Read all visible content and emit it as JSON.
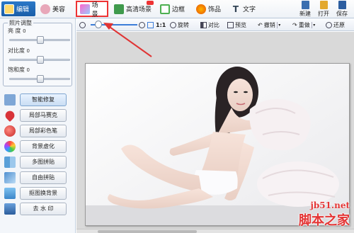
{
  "menu": {
    "tabs": [
      {
        "label": "编辑",
        "icon": "edit-icon",
        "active": true
      },
      {
        "label": "美容",
        "icon": "beauty-icon"
      },
      {
        "label": "场景",
        "icon": "scene-icon",
        "highlighted": true
      },
      {
        "label": "高清场景",
        "icon": "hd-scene-icon"
      },
      {
        "label": "边框",
        "icon": "frame-icon"
      },
      {
        "label": "饰品",
        "icon": "ornament-icon"
      },
      {
        "label": "文字",
        "icon": "text-icon"
      }
    ],
    "right_buttons": [
      {
        "label": "新建",
        "icon": "new-file-icon"
      },
      {
        "label": "打开",
        "icon": "open-folder-icon"
      },
      {
        "label": "保存",
        "icon": "save-icon"
      }
    ]
  },
  "adjust": {
    "group_title": "照片调整",
    "brightness": {
      "label": "亮  度",
      "value": "0",
      "level": 0.5
    },
    "contrast": {
      "label": "对比度",
      "value": "0",
      "level": 0.5
    },
    "saturation": {
      "label": "饱和度",
      "value": "0",
      "level": 0.5
    }
  },
  "tools": [
    {
      "label": "智能修复",
      "icon": "smart-repair-icon",
      "color": "#7fa7d6",
      "active": true
    },
    {
      "label": "局部马赛克",
      "icon": "mosaic-icon",
      "color": "#d8343a"
    },
    {
      "label": "局部彩色笔",
      "icon": "color-pen-icon",
      "color": "#c62828"
    },
    {
      "label": "背景虚化",
      "icon": "blur-background-icon",
      "color": "#8e6cc0"
    },
    {
      "label": "多图拼贴",
      "icon": "multi-collage-icon",
      "color": "#5aa0d8"
    },
    {
      "label": "自由拼贴",
      "icon": "free-collage-icon",
      "color": "#4f8fd0"
    },
    {
      "label": "抠图换背景",
      "icon": "cutout-icon",
      "color": "#3c86c9"
    },
    {
      "label": "去 水 印",
      "icon": "remove-watermark-icon",
      "color": "#2b5d9c"
    }
  ],
  "toolbar": {
    "ratio_label": "1:1",
    "rotate_label": "旋转",
    "compare_label": "对比",
    "preview_label": "预览",
    "undo_label": "撤销",
    "redo_label": "重做",
    "restore_label": "还原",
    "zoom_level": 0.1
  },
  "watermark": {
    "line1": "jb51.net",
    "line2": "脚本之家"
  },
  "colors": {
    "accent": "#1a5ea8",
    "highlight_border": "#e33333",
    "arrow": "#e03535"
  }
}
